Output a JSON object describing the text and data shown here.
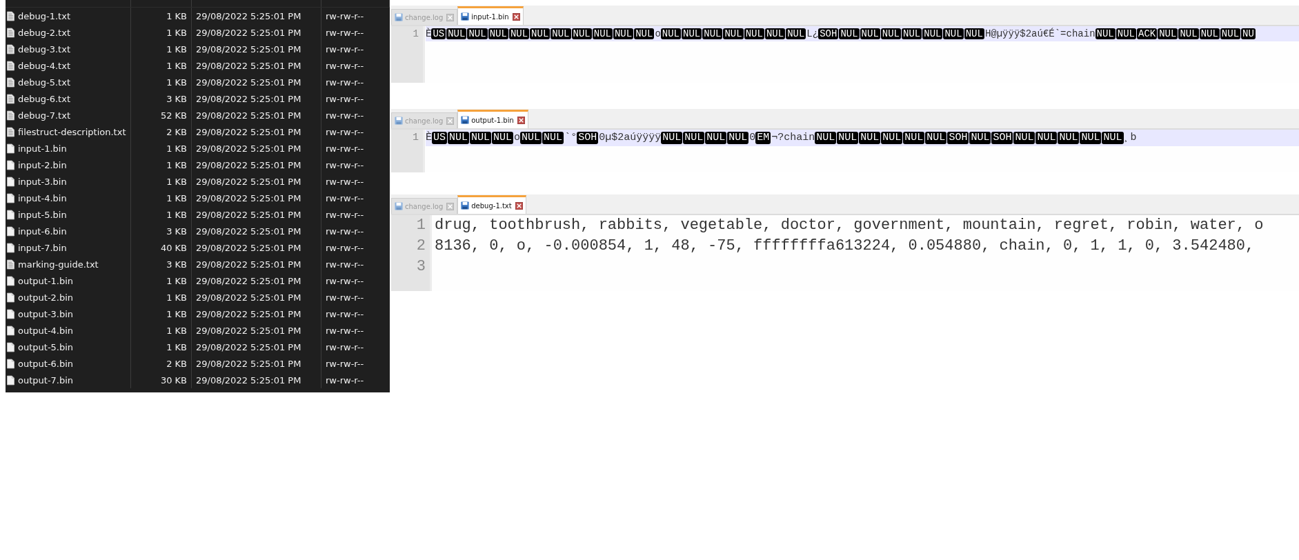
{
  "file_list": {
    "rows": [
      {
        "name": "debug-1.txt",
        "size": "1 KB",
        "modified": "29/08/2022 5:25:01 PM",
        "permissions": "rw-rw-r--",
        "kind": "text"
      },
      {
        "name": "debug-2.txt",
        "size": "1 KB",
        "modified": "29/08/2022 5:25:01 PM",
        "permissions": "rw-rw-r--",
        "kind": "text"
      },
      {
        "name": "debug-3.txt",
        "size": "1 KB",
        "modified": "29/08/2022 5:25:01 PM",
        "permissions": "rw-rw-r--",
        "kind": "text"
      },
      {
        "name": "debug-4.txt",
        "size": "1 KB",
        "modified": "29/08/2022 5:25:01 PM",
        "permissions": "rw-rw-r--",
        "kind": "text"
      },
      {
        "name": "debug-5.txt",
        "size": "1 KB",
        "modified": "29/08/2022 5:25:01 PM",
        "permissions": "rw-rw-r--",
        "kind": "text"
      },
      {
        "name": "debug-6.txt",
        "size": "3 KB",
        "modified": "29/08/2022 5:25:01 PM",
        "permissions": "rw-rw-r--",
        "kind": "text"
      },
      {
        "name": "debug-7.txt",
        "size": "52 KB",
        "modified": "29/08/2022 5:25:01 PM",
        "permissions": "rw-rw-r--",
        "kind": "text"
      },
      {
        "name": "filestruct-description.txt",
        "size": "2 KB",
        "modified": "29/08/2022 5:25:01 PM",
        "permissions": "rw-rw-r--",
        "kind": "text"
      },
      {
        "name": "input-1.bin",
        "size": "1 KB",
        "modified": "29/08/2022 5:25:01 PM",
        "permissions": "rw-rw-r--",
        "kind": "binary"
      },
      {
        "name": "input-2.bin",
        "size": "1 KB",
        "modified": "29/08/2022 5:25:01 PM",
        "permissions": "rw-rw-r--",
        "kind": "binary"
      },
      {
        "name": "input-3.bin",
        "size": "1 KB",
        "modified": "29/08/2022 5:25:01 PM",
        "permissions": "rw-rw-r--",
        "kind": "binary"
      },
      {
        "name": "input-4.bin",
        "size": "1 KB",
        "modified": "29/08/2022 5:25:01 PM",
        "permissions": "rw-rw-r--",
        "kind": "binary"
      },
      {
        "name": "input-5.bin",
        "size": "1 KB",
        "modified": "29/08/2022 5:25:01 PM",
        "permissions": "rw-rw-r--",
        "kind": "binary"
      },
      {
        "name": "input-6.bin",
        "size": "3 KB",
        "modified": "29/08/2022 5:25:01 PM",
        "permissions": "rw-rw-r--",
        "kind": "binary"
      },
      {
        "name": "input-7.bin",
        "size": "40 KB",
        "modified": "29/08/2022 5:25:01 PM",
        "permissions": "rw-rw-r--",
        "kind": "binary"
      },
      {
        "name": "marking-guide.txt",
        "size": "3 KB",
        "modified": "29/08/2022 5:25:01 PM",
        "permissions": "rw-rw-r--",
        "kind": "text"
      },
      {
        "name": "output-1.bin",
        "size": "1 KB",
        "modified": "29/08/2022 5:25:01 PM",
        "permissions": "rw-rw-r--",
        "kind": "binary"
      },
      {
        "name": "output-2.bin",
        "size": "1 KB",
        "modified": "29/08/2022 5:25:01 PM",
        "permissions": "rw-rw-r--",
        "kind": "binary"
      },
      {
        "name": "output-3.bin",
        "size": "1 KB",
        "modified": "29/08/2022 5:25:01 PM",
        "permissions": "rw-rw-r--",
        "kind": "binary"
      },
      {
        "name": "output-4.bin",
        "size": "1 KB",
        "modified": "29/08/2022 5:25:01 PM",
        "permissions": "rw-rw-r--",
        "kind": "binary"
      },
      {
        "name": "output-5.bin",
        "size": "1 KB",
        "modified": "29/08/2022 5:25:01 PM",
        "permissions": "rw-rw-r--",
        "kind": "binary"
      },
      {
        "name": "output-6.bin",
        "size": "2 KB",
        "modified": "29/08/2022 5:25:01 PM",
        "permissions": "rw-rw-r--",
        "kind": "binary"
      },
      {
        "name": "output-7.bin",
        "size": "30 KB",
        "modified": "29/08/2022 5:25:01 PM",
        "permissions": "rw-rw-r--",
        "kind": "binary"
      }
    ]
  },
  "editors": [
    {
      "tabs": [
        {
          "label": "change.log",
          "selected": false
        },
        {
          "label": "input-1.bin",
          "selected": true
        }
      ],
      "lines": [
        {
          "number": "1",
          "current": true,
          "segments": [
            {
              "kind": "text",
              "text": "È"
            },
            {
              "kind": "control",
              "text": "US"
            },
            {
              "kind": "control",
              "text": "NUL"
            },
            {
              "kind": "control",
              "text": "NUL"
            },
            {
              "kind": "control",
              "text": "NUL"
            },
            {
              "kind": "control",
              "text": "NUL"
            },
            {
              "kind": "control",
              "text": "NUL"
            },
            {
              "kind": "control",
              "text": "NUL"
            },
            {
              "kind": "control",
              "text": "NUL"
            },
            {
              "kind": "control",
              "text": "NUL"
            },
            {
              "kind": "control",
              "text": "NUL"
            },
            {
              "kind": "control",
              "text": "NUL"
            },
            {
              "kind": "text",
              "text": "o"
            },
            {
              "kind": "control",
              "text": "NUL"
            },
            {
              "kind": "control",
              "text": "NUL"
            },
            {
              "kind": "control",
              "text": "NUL"
            },
            {
              "kind": "control",
              "text": "NUL"
            },
            {
              "kind": "control",
              "text": "NUL"
            },
            {
              "kind": "control",
              "text": "NUL"
            },
            {
              "kind": "control",
              "text": "NUL"
            },
            {
              "kind": "text",
              "text": "L¿"
            },
            {
              "kind": "control",
              "text": "SOH"
            },
            {
              "kind": "control",
              "text": "NUL"
            },
            {
              "kind": "control",
              "text": "NUL"
            },
            {
              "kind": "control",
              "text": "NUL"
            },
            {
              "kind": "control",
              "text": "NUL"
            },
            {
              "kind": "control",
              "text": "NUL"
            },
            {
              "kind": "control",
              "text": "NUL"
            },
            {
              "kind": "control",
              "text": "NUL"
            },
            {
              "kind": "text",
              "text": "H@µÿÿÿ$2aú€É`=chain"
            },
            {
              "kind": "control",
              "text": "NUL"
            },
            {
              "kind": "control",
              "text": "NUL"
            },
            {
              "kind": "control",
              "text": "ACK"
            },
            {
              "kind": "control",
              "text": "NUL"
            },
            {
              "kind": "control",
              "text": "NUL"
            },
            {
              "kind": "control",
              "text": "NUL"
            },
            {
              "kind": "control",
              "text": "NUL"
            },
            {
              "kind": "control",
              "text": "NU"
            }
          ]
        }
      ]
    },
    {
      "tabs": [
        {
          "label": "change.log",
          "selected": false
        },
        {
          "label": "output-1.bin",
          "selected": true
        }
      ],
      "lines": [
        {
          "number": "1",
          "current": true,
          "segments": [
            {
              "kind": "text",
              "text": "È"
            },
            {
              "kind": "control",
              "text": "US"
            },
            {
              "kind": "control",
              "text": "NUL"
            },
            {
              "kind": "control",
              "text": "NUL"
            },
            {
              "kind": "control",
              "text": "NUL"
            },
            {
              "kind": "text",
              "text": "o"
            },
            {
              "kind": "control",
              "text": "NUL"
            },
            {
              "kind": "control",
              "text": "NUL"
            },
            {
              "kind": "text",
              "text": "`°"
            },
            {
              "kind": "control",
              "text": "SOH"
            },
            {
              "kind": "text",
              "text": "0µ$2aúÿÿÿÿ"
            },
            {
              "kind": "control",
              "text": "NUL"
            },
            {
              "kind": "control",
              "text": "NUL"
            },
            {
              "kind": "control",
              "text": "NUL"
            },
            {
              "kind": "control",
              "text": "NUL"
            },
            {
              "kind": "text",
              "text": "0"
            },
            {
              "kind": "control",
              "text": "EM"
            },
            {
              "kind": "text",
              "text": "¬?chain"
            },
            {
              "kind": "control",
              "text": "NUL"
            },
            {
              "kind": "control",
              "text": "NUL"
            },
            {
              "kind": "control",
              "text": "NUL"
            },
            {
              "kind": "control",
              "text": "NUL"
            },
            {
              "kind": "control",
              "text": "NUL"
            },
            {
              "kind": "control",
              "text": "NUL"
            },
            {
              "kind": "control",
              "text": "SOH"
            },
            {
              "kind": "control",
              "text": "NUL"
            },
            {
              "kind": "control",
              "text": "SOH"
            },
            {
              "kind": "control",
              "text": "NUL"
            },
            {
              "kind": "control",
              "text": "NUL"
            },
            {
              "kind": "control",
              "text": "NUL"
            },
            {
              "kind": "control",
              "text": "NUL"
            },
            {
              "kind": "control",
              "text": "NUL"
            },
            {
              "kind": "text",
              "text": "¸b"
            }
          ]
        }
      ]
    },
    {
      "tabs": [
        {
          "label": "change.log",
          "selected": false
        },
        {
          "label": "debug-1.txt",
          "selected": true
        }
      ],
      "lines": [
        {
          "number": "1",
          "current": false,
          "segments": [
            {
              "kind": "text",
              "text": "drug, toothbrush, rabbits, vegetable, doctor, government, mountain, regret, robin, water, o"
            }
          ]
        },
        {
          "number": "2",
          "current": false,
          "segments": [
            {
              "kind": "text",
              "text": "8136, 0, o, -0.000854, 1, 48, -75, ffffffffa613224, 0.054880, chain, 0, 1, 1, 0, 3.542480,"
            }
          ]
        },
        {
          "number": "3",
          "current": false
        }
      ]
    }
  ]
}
